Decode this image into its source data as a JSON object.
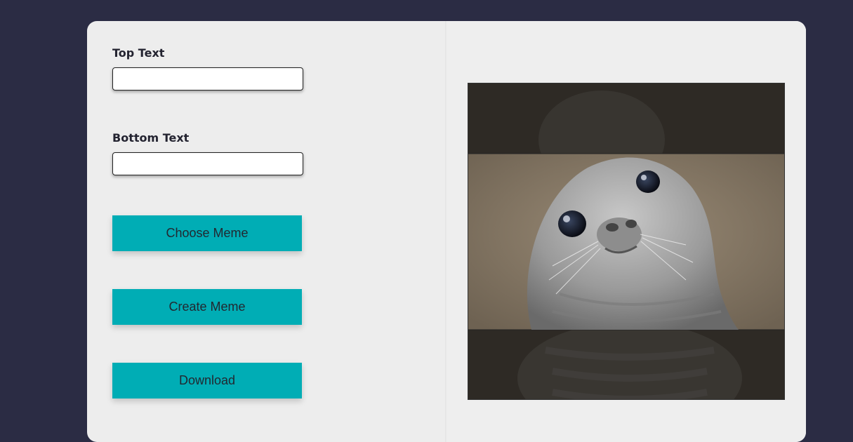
{
  "form": {
    "top_text_label": "Top Text",
    "top_text_value": "",
    "bottom_text_label": "Bottom Text",
    "bottom_text_value": ""
  },
  "buttons": {
    "choose_label": "Choose Meme",
    "create_label": "Create Meme",
    "download_label": "Download"
  },
  "preview": {
    "image_subject": "awkward-seal",
    "top_caption": "",
    "bottom_caption": ""
  },
  "colors": {
    "page_background": "#2b2c44",
    "card_background": "#ededed",
    "button_accent": "#00adb5",
    "button_text": "#222831"
  }
}
